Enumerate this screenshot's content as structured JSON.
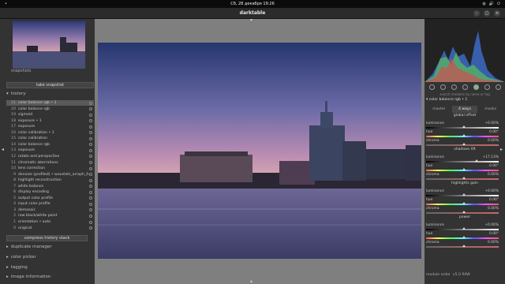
{
  "topbar": {
    "activities": "•",
    "clock": "Сб, 28 декабря  19:26",
    "tray": [
      "◍",
      "🔊",
      "⏻"
    ]
  },
  "window": {
    "title": "darktable",
    "buttons": [
      "–",
      "□",
      "×"
    ]
  },
  "left": {
    "snapshots_label": "snapshots",
    "take_snapshot": "take snapshot",
    "history_label": "history",
    "history": [
      {
        "n": "21",
        "label": "color balance rgb • 1",
        "sel": true
      },
      {
        "n": "20",
        "label": "color balance rgb"
      },
      {
        "n": "19",
        "label": "sigmoid"
      },
      {
        "n": "18",
        "label": "exposure • 1"
      },
      {
        "n": "17",
        "label": "exposure"
      },
      {
        "n": "16",
        "label": "color calibration • 1"
      },
      {
        "n": "15",
        "label": "color calibration"
      },
      {
        "n": "14",
        "label": "color balance rgb"
      },
      {
        "n": "13",
        "label": "exposure"
      },
      {
        "n": "12",
        "label": "rotate and perspective"
      },
      {
        "n": "11",
        "label": "chromatic aberrations"
      },
      {
        "n": "10",
        "label": "lens correction"
      },
      {
        "n": "9",
        "label": "denoise (profiled) • wavelets_arraph_0.2"
      },
      {
        "n": "8",
        "label": "highlight reconstruction"
      },
      {
        "n": "7",
        "label": "white balance"
      },
      {
        "n": "6",
        "label": "display encoding"
      },
      {
        "n": "5",
        "label": "output color profile"
      },
      {
        "n": "4",
        "label": "input color profile"
      },
      {
        "n": "3",
        "label": "demosaic"
      },
      {
        "n": "2",
        "label": "raw black/white point"
      },
      {
        "n": "1",
        "label": "orientation • auto"
      },
      {
        "n": "0",
        "label": "original"
      }
    ],
    "compress": "compress history stack",
    "duplicate": "duplicate manager",
    "picker": "color picker",
    "tagging": "tagging",
    "info": "image information"
  },
  "right": {
    "search_placeholder": "search modules by name or tag",
    "module_name": "color balance rgb • 1",
    "tabs": [
      "master",
      "4 ways",
      "masks"
    ],
    "sections": [
      {
        "title": "global offset",
        "luminance": "+0.00%",
        "hue": "0.00°",
        "chroma": "0.00%"
      },
      {
        "title": "shadows lift",
        "luminance": "+17.13%",
        "hue": "0.00°",
        "chroma": "0.00%"
      },
      {
        "title": "highlights gain",
        "luminance": "+0.00%",
        "hue": "0.00°",
        "chroma": "0.00%"
      },
      {
        "title": "power",
        "luminance": "+0.00%",
        "hue": "0.00°",
        "chroma": "0.00%"
      }
    ],
    "labels": {
      "luminance": "luminance",
      "hue": "hue",
      "chroma": "chroma"
    },
    "module_order": "module order",
    "module_order_val": "v5.0 RAW"
  }
}
